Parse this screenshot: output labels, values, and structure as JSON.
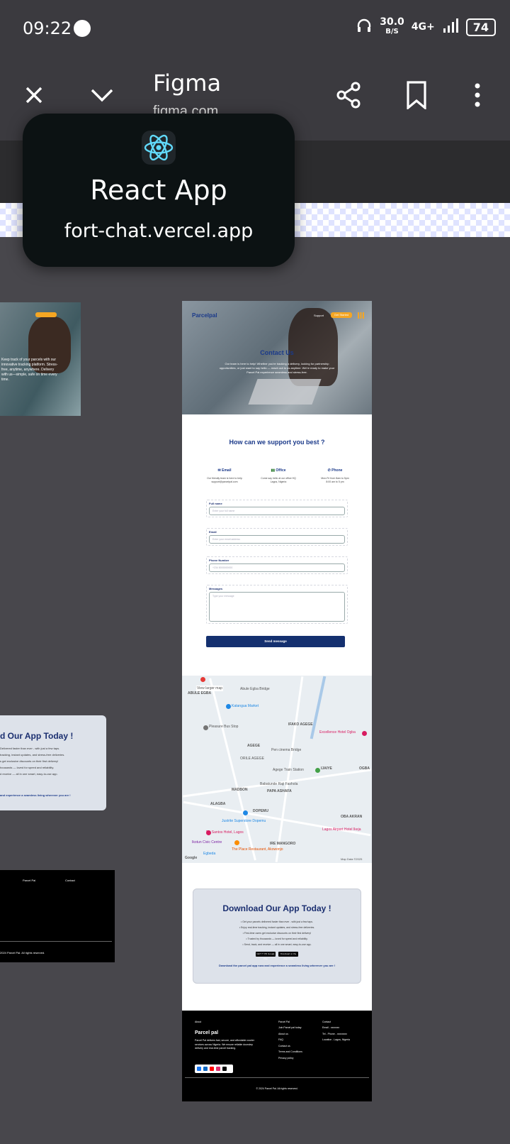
{
  "status_bar": {
    "time": "09:22",
    "net_speed": "30.0",
    "net_unit": "B/S",
    "network": "4G+",
    "battery": "74"
  },
  "browser": {
    "title": "Figma",
    "subtitle": "figma.com"
  },
  "popup": {
    "app_name": "React App",
    "url": "fort-chat.vercel.app"
  },
  "left_frames": {
    "hero_text": "Keep track of your parcels with our innovative tracking platform. Stress-free, anytime, anywhere. Delivery with us—simple, safe on time every time.",
    "dl_title": "d Our App Today !",
    "dl_lines": [
      "Delivered faster than ever - with just a few taps.",
      "tracking, instant updates, and stress-free deliveries.",
      "s get exclusive discounts on their first delivery!",
      "housands — loved for speed and reliability.",
      "d receive — all in one smart, easy-to-use app."
    ],
    "dl_foot": "and experience a seamless living wherever you are !",
    "footer_cols": [
      "Parcel Pal",
      "Contact"
    ],
    "footer_copy": "2024 Parcel Pal. All rights reserved."
  },
  "frame": {
    "brand": "Parcelpal",
    "nav_link": "Support",
    "cta": "Get Started",
    "hero_title": "Contact Us",
    "hero_desc": "Our team is here to help! Whether you're tracking a delivery, looking for partnership opportunities, or just want to say hello — reach out to us anytime. We're ready to make your Parcel Pal experience seamless and stress-free.",
    "section_title": "How can we support you best ?",
    "info": [
      {
        "title": "Email",
        "line1": "Our friendly team is here to help",
        "line2": "support@parcelpal.com"
      },
      {
        "title": "Office",
        "line1": "Come say hello at our office HQ",
        "line2": "Lagos, Nigeria"
      },
      {
        "title": "Phone",
        "line1": "Mon-Fri from 8am to 5pm",
        "line2": "8:00 am to 5 pm"
      }
    ],
    "fields": [
      {
        "label": "Full name",
        "placeholder": "Enter your full name"
      },
      {
        "label": "Email",
        "placeholder": "Enter your email address"
      },
      {
        "label": "Phone Number",
        "placeholder": "+234  8000000000"
      },
      {
        "label": "Messages",
        "placeholder": "Type your message"
      }
    ],
    "send_label": "Send message",
    "map_labels": [
      "ABULE EGBA",
      "Abule Egba Bridge",
      "Katangua Market",
      "Pleasure Bus Stop",
      "IFAKO AGEGE",
      "Excellence Hotel Ogba",
      "AGEGE",
      "Pen cinema Bridge",
      "ORILE AGEGE",
      "Agege Train Station",
      "IJAIYE",
      "OGBA",
      "Babatunde Raji Fashola",
      "PAPA ASHAFA",
      "MADBON",
      "ALAGBA",
      "DOPEMU",
      "OBA AKRAN",
      "Justrite Superstore Dopemu",
      "Lagos Airport Hotel Ikeja",
      "De Santos Hotel, Lagos",
      "Ikotun Civic Centre",
      "The Place Restaurant, Akowonjo",
      "IRE MANGORO",
      "Egbeda",
      "Google",
      "Map Data ©2025",
      "View larger map"
    ],
    "dl_title": "Download Our App Today !",
    "dl_lines": [
      "• Get your parcels delivered faster than ever - with just a few taps.",
      "• Enjoy real-time tracking, instant updates, and stress-free deliveries.",
      "• First-time users get exclusive discounts on their first delivery!",
      "• Trusted by thousands — loved for speed and reliability.",
      "• Send, track, and receive — all in one smart, easy-to-use app."
    ],
    "google_play": "GET IT ON Google Play",
    "app_store": "Download on the App Store",
    "dl_foot": "Download the parcel pal app now and experience a seamless living wherever you are !",
    "footer": {
      "about_h": "About",
      "brand": "Parcel pal",
      "about_text": "Parcel Pal delivers fast, secure, and affordable courier services across Nigeria. We ensure reliable doorstep delivery and real-time parcel tracking.",
      "col1_h": "Parcel Pal",
      "col1": [
        "Join Parcel pal today",
        "About us",
        "FAQ",
        "Contact us",
        "Terms and Conditions",
        "Privacy policy"
      ],
      "col2_h": "Contact",
      "col2": [
        "Email - xxxxxxx",
        "Tel - Phone - xxxxxxxx",
        "Location - Lagos, Nigeria"
      ],
      "copy": "© 2024 Parcel Pal. All rights reserved."
    }
  }
}
